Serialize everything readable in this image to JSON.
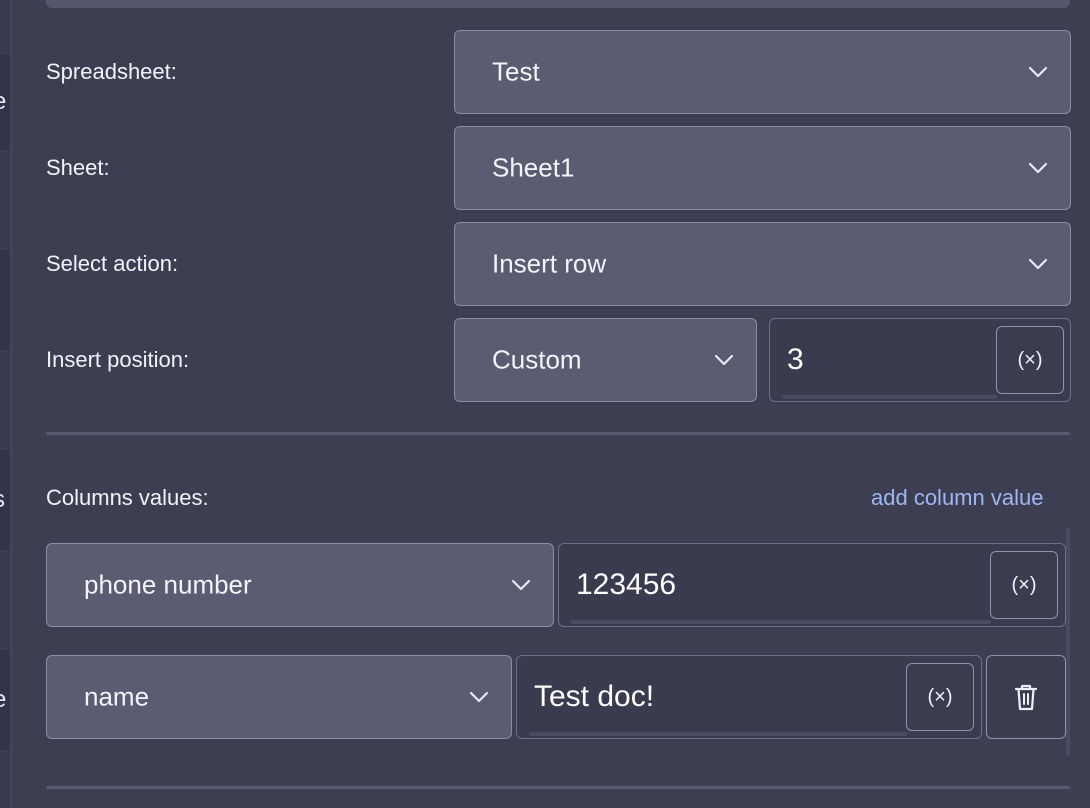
{
  "edge": {
    "glyphs": [
      "e",
      "s",
      "e"
    ]
  },
  "form": {
    "spreadsheet": {
      "label": "Spreadsheet:",
      "value": "Test"
    },
    "sheet": {
      "label": "Sheet:",
      "value": "Sheet1"
    },
    "action": {
      "label": "Select action:",
      "value": "Insert row"
    },
    "position": {
      "label": "Insert position:",
      "mode": "Custom",
      "value": "3"
    },
    "columns": {
      "label": "Columns values:",
      "add_link": "add column value",
      "rows": [
        {
          "column": "phone number",
          "value": "123456"
        },
        {
          "column": "name",
          "value": "Test doc!"
        }
      ]
    }
  },
  "icons": {
    "variable": "variable-icon",
    "chevron": "chevron-down-icon",
    "delete": "trash-icon"
  },
  "colors": {
    "background": "#3d3e52",
    "select_bg": "#5b5c72",
    "link": "#9fb6f2"
  }
}
